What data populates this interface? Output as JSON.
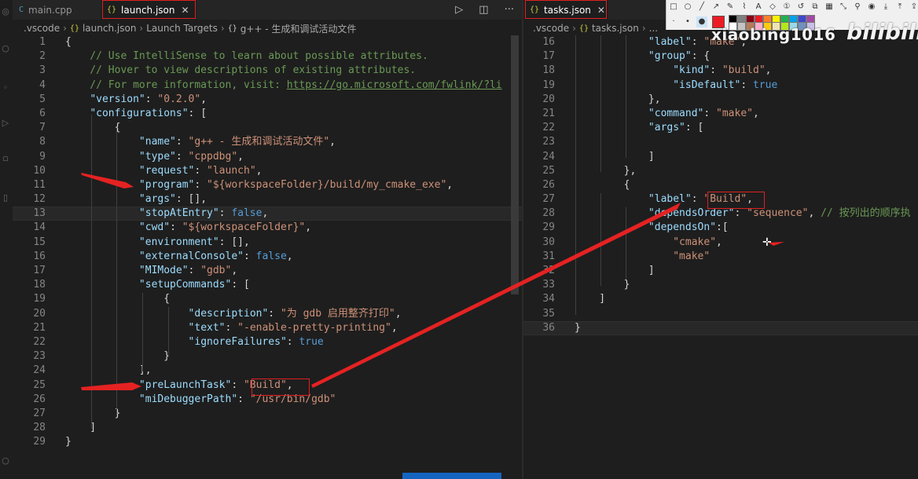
{
  "left_tabs": [
    {
      "icon": "C",
      "label": "main.cpp",
      "active": false
    },
    {
      "icon": "{}",
      "label": "launch.json",
      "active": true
    }
  ],
  "right_tabs": [
    {
      "icon": "{}",
      "label": "tasks.json",
      "active": true
    }
  ],
  "left_breadcrumb": [
    ".vscode",
    "launch.json",
    "Launch Targets",
    "g++ - 生成和调试活动文件"
  ],
  "right_breadcrumb": [
    ".vscode",
    "tasks.json",
    "..."
  ],
  "left_lines": [
    {
      "n": "1",
      "t": [
        [
          "{",
          "p"
        ]
      ]
    },
    {
      "n": "2",
      "t": [
        [
          "    // Use IntelliSense to learn about possible attributes.",
          "c"
        ]
      ]
    },
    {
      "n": "3",
      "t": [
        [
          "    // Hover to view descriptions of existing attributes.",
          "c"
        ]
      ]
    },
    {
      "n": "4",
      "t": [
        [
          "    // For more information, visit: ",
          "c"
        ],
        [
          "https://go.microsoft.com/fwlink/?li",
          "u"
        ]
      ]
    },
    {
      "n": "5",
      "t": [
        [
          "    ",
          "p"
        ],
        [
          "\"version\"",
          "k"
        ],
        [
          ": ",
          "p"
        ],
        [
          "\"0.2.0\"",
          "s"
        ],
        [
          ",",
          "p"
        ]
      ]
    },
    {
      "n": "6",
      "t": [
        [
          "    ",
          "p"
        ],
        [
          "\"configurations\"",
          "k"
        ],
        [
          ": [",
          "p"
        ]
      ]
    },
    {
      "n": "7",
      "t": [
        [
          "        {",
          "p"
        ]
      ]
    },
    {
      "n": "8",
      "t": [
        [
          "            ",
          "p"
        ],
        [
          "\"name\"",
          "k"
        ],
        [
          ": ",
          "p"
        ],
        [
          "\"g++ - 生成和调试活动文件\"",
          "s"
        ],
        [
          ",",
          "p"
        ]
      ]
    },
    {
      "n": "9",
      "t": [
        [
          "            ",
          "p"
        ],
        [
          "\"type\"",
          "k"
        ],
        [
          ": ",
          "p"
        ],
        [
          "\"cppdbg\"",
          "s"
        ],
        [
          ",",
          "p"
        ]
      ]
    },
    {
      "n": "10",
      "t": [
        [
          "            ",
          "p"
        ],
        [
          "\"request\"",
          "k"
        ],
        [
          ": ",
          "p"
        ],
        [
          "\"launch\"",
          "s"
        ],
        [
          ",",
          "p"
        ]
      ]
    },
    {
      "n": "11",
      "t": [
        [
          "            ",
          "p"
        ],
        [
          "\"program\"",
          "k"
        ],
        [
          ": ",
          "p"
        ],
        [
          "\"${workspaceFolder}/build/my_cmake_exe\"",
          "s"
        ],
        [
          ",",
          "p"
        ]
      ]
    },
    {
      "n": "12",
      "t": [
        [
          "            ",
          "p"
        ],
        [
          "\"args\"",
          "k"
        ],
        [
          ": [],",
          "p"
        ]
      ]
    },
    {
      "n": "13",
      "t": [
        [
          "            ",
          "p"
        ],
        [
          "\"stopAtEntry\"",
          "k"
        ],
        [
          ": ",
          "p"
        ],
        [
          "false",
          "b"
        ],
        [
          ",",
          "p"
        ]
      ],
      "current": true
    },
    {
      "n": "14",
      "t": [
        [
          "            ",
          "p"
        ],
        [
          "\"cwd\"",
          "k"
        ],
        [
          ": ",
          "p"
        ],
        [
          "\"${workspaceFolder}\"",
          "s"
        ],
        [
          ",",
          "p"
        ]
      ]
    },
    {
      "n": "15",
      "t": [
        [
          "            ",
          "p"
        ],
        [
          "\"environment\"",
          "k"
        ],
        [
          ": [],",
          "p"
        ]
      ]
    },
    {
      "n": "16",
      "t": [
        [
          "            ",
          "p"
        ],
        [
          "\"externalConsole\"",
          "k"
        ],
        [
          ": ",
          "p"
        ],
        [
          "false",
          "b"
        ],
        [
          ",",
          "p"
        ]
      ]
    },
    {
      "n": "17",
      "t": [
        [
          "            ",
          "p"
        ],
        [
          "\"MIMode\"",
          "k"
        ],
        [
          ": ",
          "p"
        ],
        [
          "\"gdb\"",
          "s"
        ],
        [
          ",",
          "p"
        ]
      ]
    },
    {
      "n": "18",
      "t": [
        [
          "            ",
          "p"
        ],
        [
          "\"setupCommands\"",
          "k"
        ],
        [
          ": [",
          "p"
        ]
      ]
    },
    {
      "n": "19",
      "t": [
        [
          "                {",
          "p"
        ]
      ]
    },
    {
      "n": "20",
      "t": [
        [
          "                    ",
          "p"
        ],
        [
          "\"description\"",
          "k"
        ],
        [
          ": ",
          "p"
        ],
        [
          "\"为 gdb 启用整齐打印\"",
          "s"
        ],
        [
          ",",
          "p"
        ]
      ]
    },
    {
      "n": "21",
      "t": [
        [
          "                    ",
          "p"
        ],
        [
          "\"text\"",
          "k"
        ],
        [
          ": ",
          "p"
        ],
        [
          "\"-enable-pretty-printing\"",
          "s"
        ],
        [
          ",",
          "p"
        ]
      ]
    },
    {
      "n": "22",
      "t": [
        [
          "                    ",
          "p"
        ],
        [
          "\"ignoreFailures\"",
          "k"
        ],
        [
          ": ",
          "p"
        ],
        [
          "true",
          "b"
        ]
      ]
    },
    {
      "n": "23",
      "t": [
        [
          "                }",
          "p"
        ]
      ]
    },
    {
      "n": "24",
      "t": [
        [
          "            ],",
          "p"
        ]
      ]
    },
    {
      "n": "25",
      "t": [
        [
          "            ",
          "p"
        ],
        [
          "\"preLaunchTask\"",
          "k"
        ],
        [
          ": ",
          "p"
        ],
        [
          "\"Build\"",
          "s"
        ],
        [
          ",",
          "p"
        ]
      ]
    },
    {
      "n": "26",
      "t": [
        [
          "            ",
          "p"
        ],
        [
          "\"miDebuggerPath\"",
          "k"
        ],
        [
          ": ",
          "p"
        ],
        [
          "\"/usr/bin/gdb\"",
          "s"
        ]
      ]
    },
    {
      "n": "27",
      "t": [
        [
          "        }",
          "p"
        ]
      ]
    },
    {
      "n": "28",
      "t": [
        [
          "    ]",
          "p"
        ]
      ]
    },
    {
      "n": "29",
      "t": [
        [
          "}",
          "p"
        ]
      ]
    }
  ],
  "right_lines": [
    {
      "n": "16",
      "t": [
        [
          "            ",
          "p"
        ],
        [
          "\"label\"",
          "k"
        ],
        [
          ": ",
          "p"
        ],
        [
          "\"make\"",
          "s"
        ],
        [
          ",",
          "p"
        ]
      ]
    },
    {
      "n": "17",
      "t": [
        [
          "            ",
          "p"
        ],
        [
          "\"group\"",
          "k"
        ],
        [
          ": {",
          "p"
        ]
      ]
    },
    {
      "n": "18",
      "t": [
        [
          "                ",
          "p"
        ],
        [
          "\"kind\"",
          "k"
        ],
        [
          ": ",
          "p"
        ],
        [
          "\"build\"",
          "s"
        ],
        [
          ",",
          "p"
        ]
      ]
    },
    {
      "n": "19",
      "t": [
        [
          "                ",
          "p"
        ],
        [
          "\"isDefault\"",
          "k"
        ],
        [
          ": ",
          "p"
        ],
        [
          "true",
          "b"
        ]
      ]
    },
    {
      "n": "20",
      "t": [
        [
          "            },",
          "p"
        ]
      ]
    },
    {
      "n": "21",
      "t": [
        [
          "            ",
          "p"
        ],
        [
          "\"command\"",
          "k"
        ],
        [
          ": ",
          "p"
        ],
        [
          "\"make\"",
          "s"
        ],
        [
          ",",
          "p"
        ]
      ]
    },
    {
      "n": "22",
      "t": [
        [
          "            ",
          "p"
        ],
        [
          "\"args\"",
          "k"
        ],
        [
          ": [",
          "p"
        ]
      ]
    },
    {
      "n": "23",
      "t": [
        [
          "",
          "p"
        ]
      ]
    },
    {
      "n": "24",
      "t": [
        [
          "            ]",
          "p"
        ]
      ]
    },
    {
      "n": "25",
      "t": [
        [
          "        },",
          "p"
        ]
      ]
    },
    {
      "n": "26",
      "t": [
        [
          "        {",
          "p"
        ]
      ]
    },
    {
      "n": "27",
      "t": [
        [
          "            ",
          "p"
        ],
        [
          "\"label\"",
          "k"
        ],
        [
          ": ",
          "p"
        ],
        [
          "\"Build\"",
          "s"
        ],
        [
          ",",
          "p"
        ]
      ]
    },
    {
      "n": "28",
      "t": [
        [
          "            ",
          "p"
        ],
        [
          "\"dependsOrder\"",
          "k"
        ],
        [
          ": ",
          "p"
        ],
        [
          "\"sequence\"",
          "s"
        ],
        [
          ", ",
          "p"
        ],
        [
          "// 按列出的顺序执",
          "c"
        ]
      ]
    },
    {
      "n": "29",
      "t": [
        [
          "            ",
          "p"
        ],
        [
          "\"dependsOn\"",
          "k"
        ],
        [
          ":[",
          "p"
        ]
      ]
    },
    {
      "n": "30",
      "t": [
        [
          "                ",
          "p"
        ],
        [
          "\"cmake\"",
          "s"
        ],
        [
          ",",
          "p"
        ]
      ]
    },
    {
      "n": "31",
      "t": [
        [
          "                ",
          "p"
        ],
        [
          "\"make\"",
          "s"
        ]
      ]
    },
    {
      "n": "32",
      "t": [
        [
          "            ]",
          "p"
        ]
      ]
    },
    {
      "n": "33",
      "t": [
        [
          "        }",
          "p"
        ]
      ]
    },
    {
      "n": "34",
      "t": [
        [
          "    ]",
          "p"
        ]
      ]
    },
    {
      "n": "35",
      "t": [
        [
          "",
          "p"
        ]
      ]
    },
    {
      "n": "36",
      "t": [
        [
          "}",
          "p"
        ]
      ],
      "current": true
    }
  ],
  "watermark": {
    "user": "xiaobing1016",
    "logo": "bilibili"
  },
  "toolbar": {
    "colors": [
      "#000000",
      "#7f7f7f",
      "#880015",
      "#ed1c24",
      "#ff7f27",
      "#fff200",
      "#22b14c",
      "#00a2e8",
      "#3f48cc",
      "#a349a4",
      "#ffffff",
      "#c3c3c3",
      "#b97a57",
      "#ffaec9",
      "#ffc90e",
      "#efe4b0",
      "#b5e61d",
      "#99d9ea",
      "#7092be",
      "#c8bfe7"
    ],
    "active_color": "#ed1c24"
  }
}
